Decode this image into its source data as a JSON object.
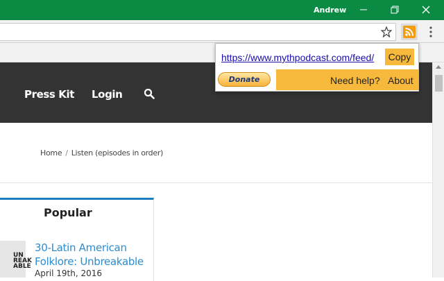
{
  "window": {
    "user": "Andrew"
  },
  "nav": {
    "items": [
      "Press Kit",
      "Login"
    ]
  },
  "breadcrumb": {
    "home": "Home",
    "separator": "/",
    "current": "Listen (episodes in order)"
  },
  "popular": {
    "title": "Popular",
    "post": {
      "title": "30-Latin American Folklore: Unbreakable",
      "date": "April 19th, 2016",
      "thumb_text": "UN REAK ABLE"
    }
  },
  "popup": {
    "feed_url": "https://www.mythpodcast.com/feed/",
    "copy_label": "Copy",
    "donate_label": "Donate",
    "help_label": "Need help?",
    "about_label": "About"
  },
  "colors": {
    "titlebar": "#0b8a44",
    "accent": "#f6b93b",
    "nav_bg": "#333333",
    "link": "#2b8cd0"
  },
  "icons": [
    "minimize-icon",
    "restore-icon",
    "close-icon",
    "star-icon",
    "rss-icon",
    "menu-icon",
    "search-icon"
  ]
}
